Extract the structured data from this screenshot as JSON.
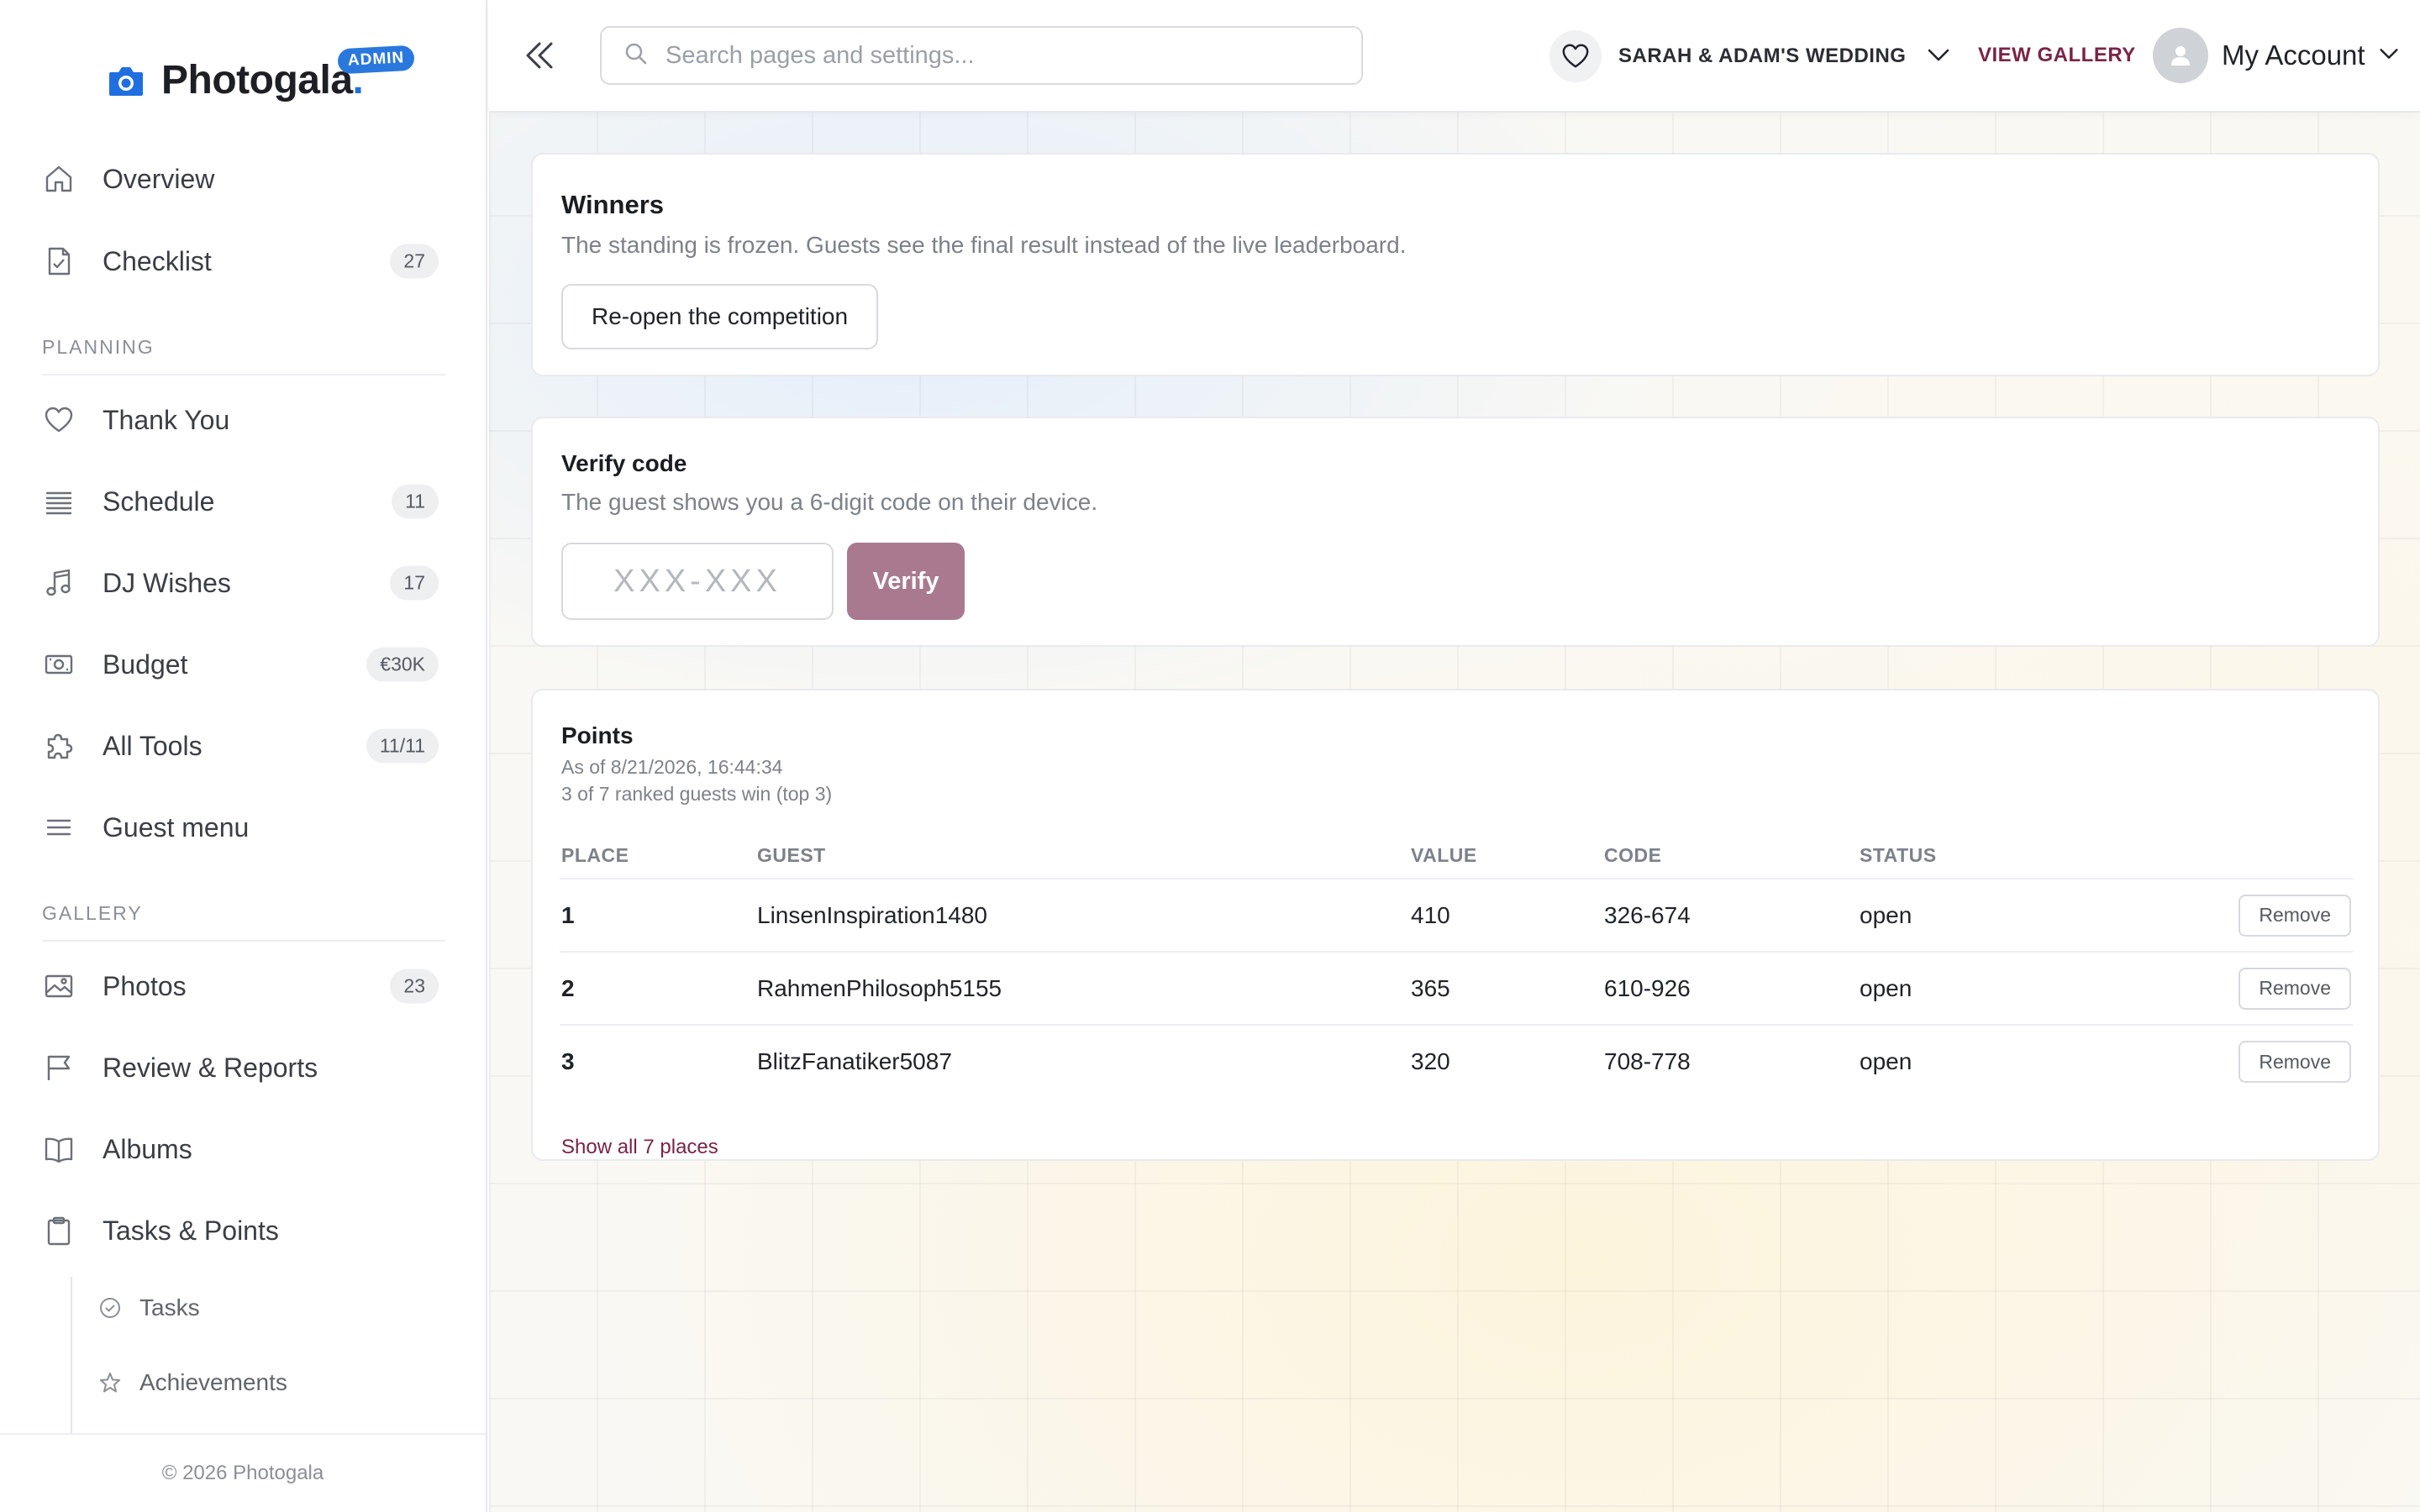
{
  "brand": {
    "name": "Photogala",
    "dot": ".",
    "badge": "ADMIN"
  },
  "colors": {
    "accent": "#7a2447",
    "brand_blue": "#1f6fe0",
    "verify_button": "#a97a8f"
  },
  "sidebar": {
    "items": [
      {
        "label": "Overview",
        "icon": "home-icon",
        "count": ""
      },
      {
        "label": "Checklist",
        "icon": "checklist-icon",
        "count": "27"
      }
    ],
    "sections": [
      {
        "title": "PLANNING",
        "items": [
          {
            "label": "Thank You",
            "icon": "heart-icon",
            "count": ""
          },
          {
            "label": "Schedule",
            "icon": "schedule-icon",
            "count": "11"
          },
          {
            "label": "DJ Wishes",
            "icon": "music-note-icon",
            "count": "17"
          },
          {
            "label": "Budget",
            "icon": "money-icon",
            "count": "€30K"
          },
          {
            "label": "All Tools",
            "icon": "puzzle-icon",
            "count": "11/11"
          },
          {
            "label": "Guest menu",
            "icon": "menu-icon",
            "count": ""
          }
        ]
      },
      {
        "title": "GALLERY",
        "items": [
          {
            "label": "Photos",
            "icon": "image-icon",
            "count": "23"
          },
          {
            "label": "Review & Reports",
            "icon": "flag-icon",
            "count": ""
          },
          {
            "label": "Albums",
            "icon": "book-icon",
            "count": ""
          },
          {
            "label": "Tasks & Points",
            "icon": "clipboard-icon",
            "count": ""
          }
        ]
      }
    ],
    "subitems": [
      {
        "label": "Tasks",
        "icon": "check-circle-icon"
      },
      {
        "label": "Achievements",
        "icon": "star-icon"
      }
    ],
    "footer": "© 2026 Photogala"
  },
  "topbar": {
    "search_placeholder": "Search pages and settings...",
    "event_name": "SARAH & ADAM'S WEDDING",
    "view_gallery": "VIEW GALLERY",
    "account": "My Account"
  },
  "winners": {
    "title": "Winners",
    "description": "The standing is frozen. Guests see the final result instead of the live leaderboard.",
    "button": "Re-open the competition"
  },
  "verify": {
    "title": "Verify code",
    "description": "The guest shows you a 6-digit code on their device.",
    "placeholder": "XXX-XXX",
    "button": "Verify"
  },
  "points": {
    "title": "Points",
    "as_of": "As of 8/21/2026, 16:44:34",
    "summary": "3 of 7 ranked guests win (top 3)",
    "columns": [
      "PLACE",
      "GUEST",
      "VALUE",
      "CODE",
      "STATUS"
    ],
    "rows": [
      {
        "place": "1",
        "guest": "LinsenInspiration1480",
        "value": "410",
        "code": "326-674",
        "status": "open",
        "action": "Remove"
      },
      {
        "place": "2",
        "guest": "RahmenPhilosoph5155",
        "value": "365",
        "code": "610-926",
        "status": "open",
        "action": "Remove"
      },
      {
        "place": "3",
        "guest": "BlitzFanatiker5087",
        "value": "320",
        "code": "708-778",
        "status": "open",
        "action": "Remove"
      }
    ],
    "show_all": "Show all 7 places"
  }
}
